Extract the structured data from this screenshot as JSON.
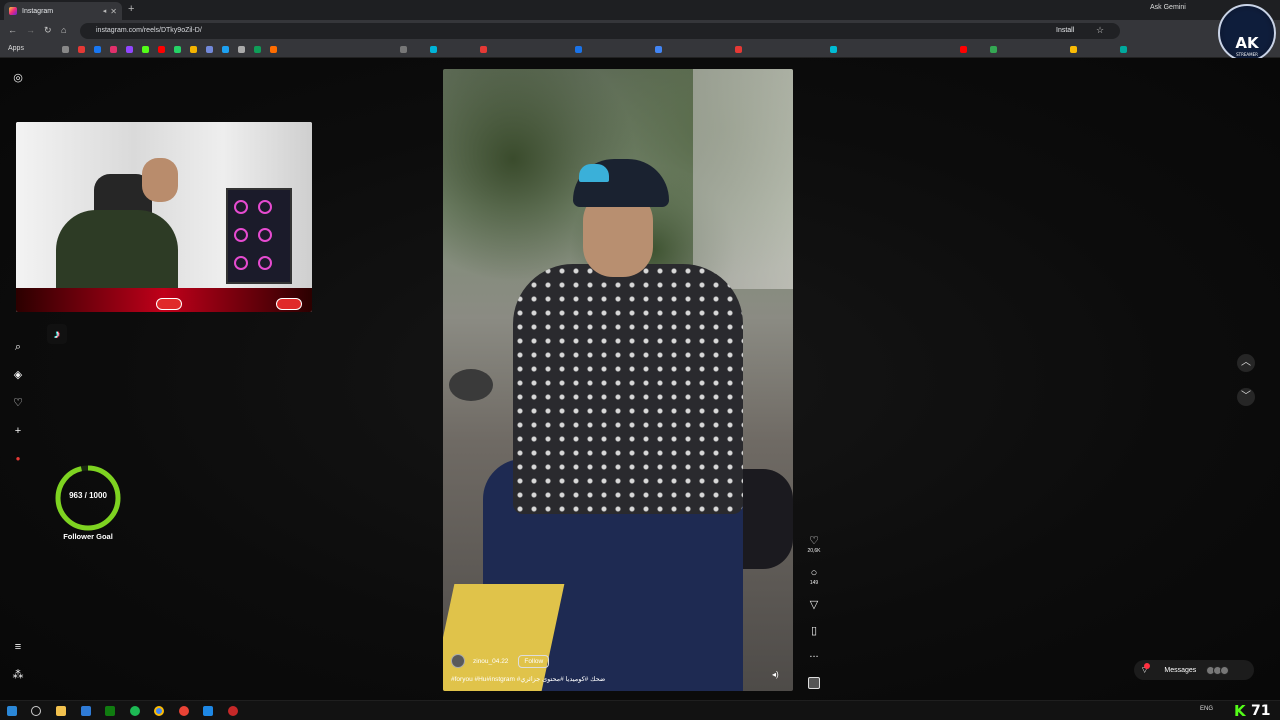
{
  "browser": {
    "tab_title": "Instagram",
    "new_tab": "+",
    "ask_gemini": "Ask Gemini",
    "url": "instagram.com/reels/DTky9oZil-D/",
    "install_label": "Install",
    "bookmarks_apps": "Apps"
  },
  "channel_logo": {
    "text": "AK",
    "sub": "STREAMER"
  },
  "sidebar": {
    "icons": [
      "instagram-icon",
      "search-icon",
      "explore-icon",
      "heart-icon",
      "create-icon",
      "more-icon",
      "meta-icon"
    ]
  },
  "overlay": {
    "follower_goal": {
      "current": 963,
      "target": 1000,
      "text": "963 / 1000",
      "label": "Follower Goal"
    }
  },
  "reel": {
    "username": "zinou_04.22",
    "follow_label": "Follow",
    "caption": "#foryou #Hu#instgram #ضحك #كوميديا #محتوى جزائري",
    "likes": "20,6K",
    "comments": "149",
    "more": "..."
  },
  "messages": {
    "label": "Messages"
  },
  "taskbar": {
    "lang": "ENG",
    "kick_letter": "K",
    "kick_number": "71"
  },
  "colors": {
    "goal_ring": "#7ed321",
    "accent_red": "#ff3040",
    "kick_green": "#53fc18"
  }
}
